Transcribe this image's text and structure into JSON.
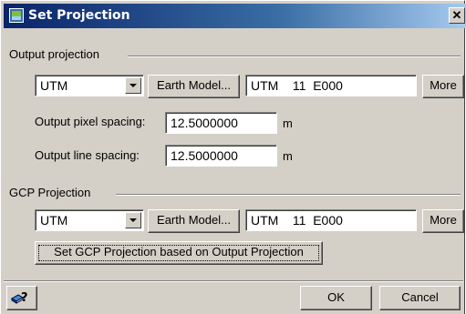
{
  "window": {
    "title": "Set Projection",
    "close_glyph": "✕"
  },
  "output": {
    "group_label": "Output projection",
    "projection": "UTM",
    "earth_model_label": "Earth Model...",
    "projection_string": "UTM    11  E000",
    "more_label": "More",
    "pixel_spacing_label": "Output pixel spacing:",
    "pixel_spacing": "12.5000000",
    "pixel_unit": "m",
    "line_spacing_label": "Output line spacing:",
    "line_spacing": "12.5000000",
    "line_unit": "m"
  },
  "gcp": {
    "group_label": "GCP Projection",
    "projection": "UTM",
    "earth_model_label": "Earth Model...",
    "projection_string": "UTM    11  E000",
    "more_label": "More",
    "set_button_label": "Set GCP Projection based on Output Projection"
  },
  "footer": {
    "help_icon": "book-question-icon",
    "ok_label": "OK",
    "cancel_label": "Cancel"
  },
  "colors": {
    "title_start": "#0a246a",
    "title_end": "#a6caf0",
    "face": "#d4d0c8"
  }
}
